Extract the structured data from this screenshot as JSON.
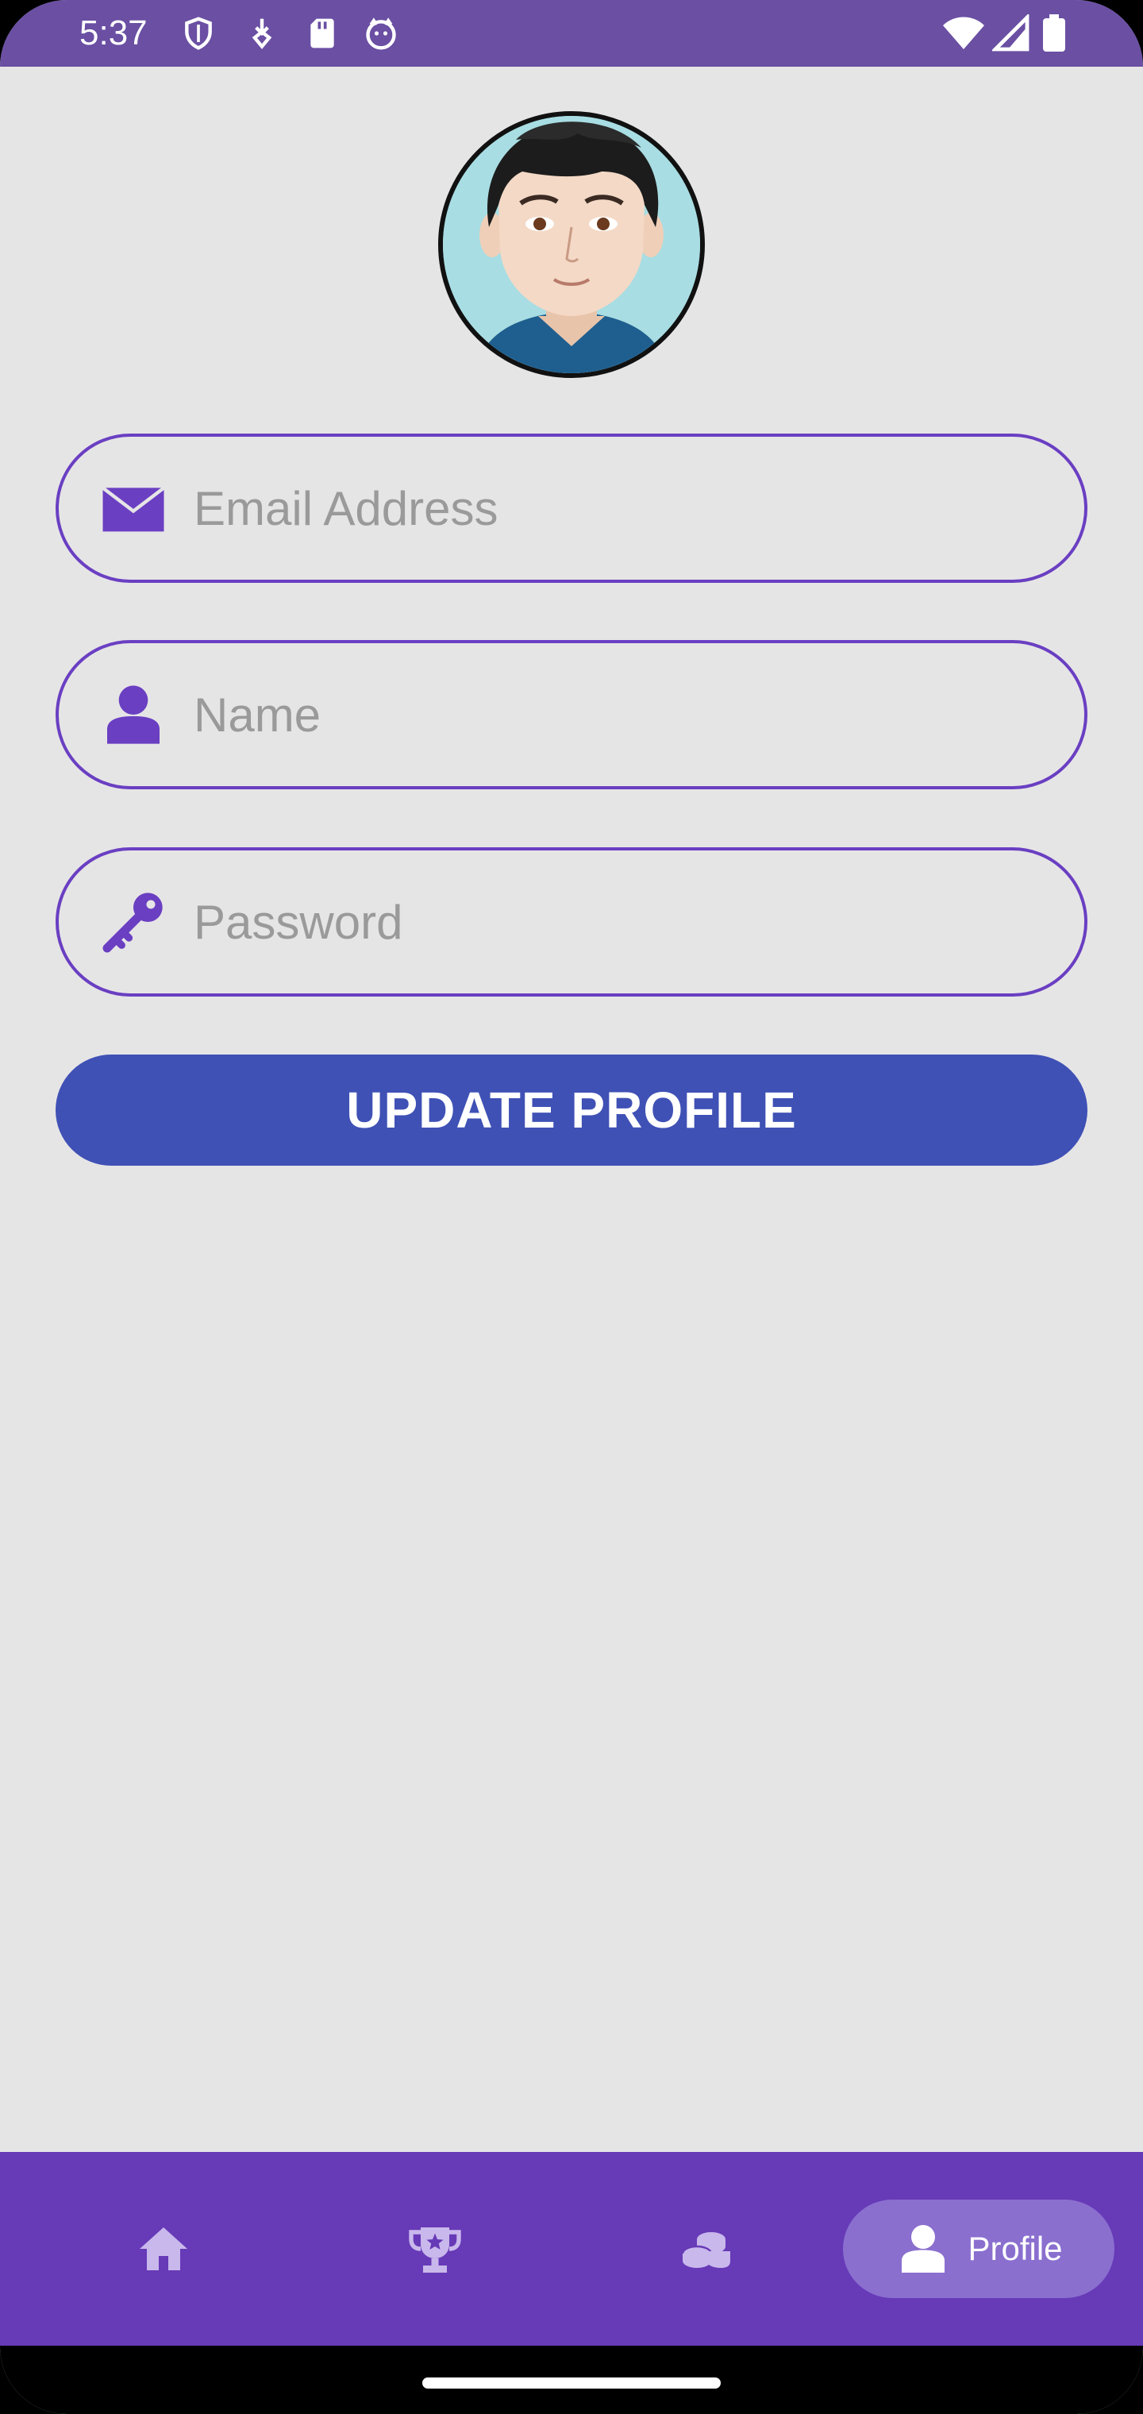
{
  "status_bar": {
    "time": "5:37",
    "icons_left": [
      "shield-icon",
      "usb-debug-icon",
      "sd-card-icon",
      "cat-face-icon"
    ],
    "icons_right": [
      "wifi-icon",
      "cellular-signal-icon",
      "battery-icon"
    ],
    "background_color": "#6a4fa3"
  },
  "profile": {
    "avatar": "cartoon-man-avatar",
    "fields": {
      "email": {
        "placeholder": "Email Address",
        "value": "",
        "icon": "envelope-icon"
      },
      "name": {
        "placeholder": "Name",
        "value": "",
        "icon": "person-icon"
      },
      "password": {
        "placeholder": "Password",
        "value": "",
        "icon": "key-icon"
      }
    },
    "update_button_label": "UPDATE PROFILE",
    "accent_color": "#6a3fc2",
    "button_color": "#3f51b5"
  },
  "bottom_nav": {
    "background_color": "#673ab7",
    "items": [
      {
        "icon": "home-icon",
        "label": "",
        "active": false
      },
      {
        "icon": "trophy-icon",
        "label": "",
        "active": false
      },
      {
        "icon": "coins-icon",
        "label": "",
        "active": false
      },
      {
        "icon": "person-icon",
        "label": "Profile",
        "active": true
      }
    ]
  }
}
